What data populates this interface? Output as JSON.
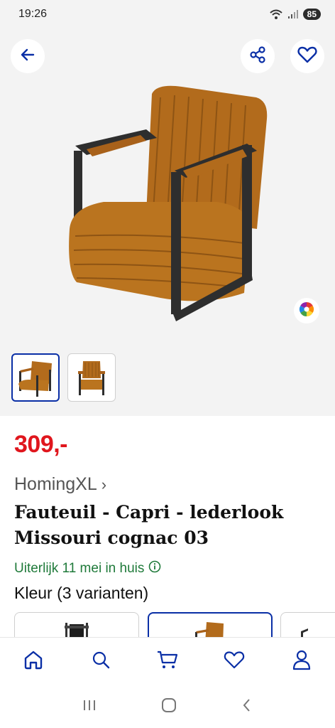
{
  "status": {
    "time": "19:26",
    "battery": "85"
  },
  "product": {
    "price": "309,-",
    "brand": "HomingXL",
    "brand_chevron": "›",
    "title": "Fauteuil - Capri - lederlook Missouri cognac 03",
    "delivery": "Uiterlijk 11 mei in huis",
    "variants_label": "Kleur (3 varianten)"
  },
  "icons": {
    "back": "arrow-left-icon",
    "share": "share-icon",
    "favorite": "heart-icon",
    "color": "color-wheel-icon",
    "info": "info-icon"
  },
  "bottom_nav": [
    {
      "name": "home",
      "icon": "home-icon",
      "active": true
    },
    {
      "name": "search",
      "icon": "search-icon",
      "active": false
    },
    {
      "name": "cart",
      "icon": "cart-icon",
      "active": false
    },
    {
      "name": "wishlist",
      "icon": "heart-icon",
      "active": false
    },
    {
      "name": "account",
      "icon": "user-icon",
      "active": false
    }
  ],
  "colors": {
    "accent": "#0a2fa6",
    "price": "#e0161d",
    "delivery": "#1f7a3a"
  }
}
